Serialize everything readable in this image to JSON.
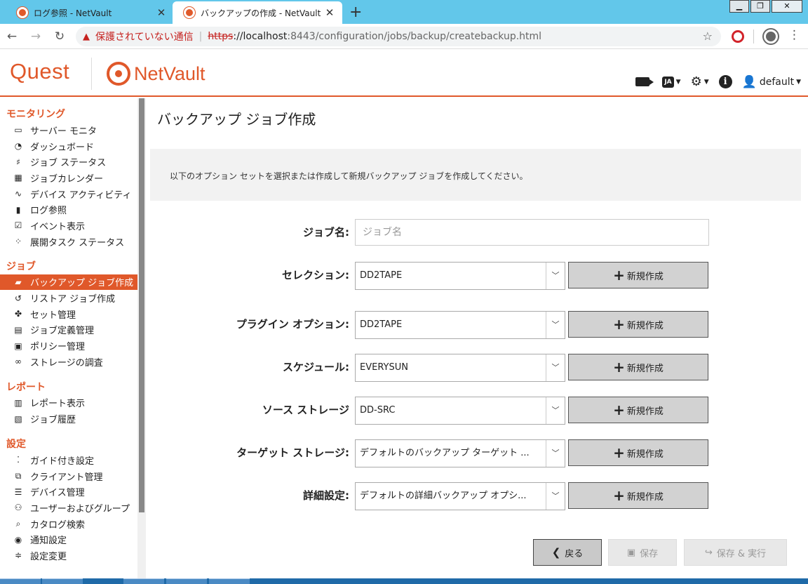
{
  "browser": {
    "tabs": [
      {
        "title": "ログ参照 - NetVault",
        "active": false
      },
      {
        "title": "バックアップの作成 - NetVault",
        "active": true
      }
    ],
    "new_tab": "+",
    "address": {
      "security_warning": "保護されていない通信",
      "scheme": "https",
      "host": "://localhost",
      "path": ":8443/configuration/jobs/backup/createbackup.html"
    }
  },
  "header": {
    "brand": "Quest",
    "product": "NetVault",
    "language": "JA",
    "user": "default"
  },
  "sidebar": {
    "groups": [
      {
        "title": "モニタリング",
        "items": [
          {
            "label": "サーバー モニタ",
            "icon": "monitor-icon"
          },
          {
            "label": "ダッシュボード",
            "icon": "gauge-icon"
          },
          {
            "label": "ジョブ ステータス",
            "icon": "job-status-icon"
          },
          {
            "label": "ジョブカレンダー",
            "icon": "calendar-icon"
          },
          {
            "label": "デバイス アクティビティ",
            "icon": "activity-icon"
          },
          {
            "label": "ログ参照",
            "icon": "log-icon"
          },
          {
            "label": "イベント表示",
            "icon": "event-icon"
          },
          {
            "label": "展開タスク ステータス",
            "icon": "spinner-icon"
          }
        ]
      },
      {
        "title": "ジョブ",
        "items": [
          {
            "label": "バックアップ ジョブ作成",
            "icon": "backup-icon",
            "active": true
          },
          {
            "label": "リストア ジョブ作成",
            "icon": "restore-icon"
          },
          {
            "label": "セット管理",
            "icon": "sets-icon"
          },
          {
            "label": "ジョブ定義管理",
            "icon": "job-definition-icon"
          },
          {
            "label": "ポリシー管理",
            "icon": "policy-icon"
          },
          {
            "label": "ストレージの調査",
            "icon": "binoculars-icon"
          }
        ]
      },
      {
        "title": "レポート",
        "items": [
          {
            "label": "レポート表示",
            "icon": "report-icon"
          },
          {
            "label": "ジョブ履歴",
            "icon": "history-icon"
          }
        ]
      },
      {
        "title": "設定",
        "items": [
          {
            "label": "ガイド付き設定",
            "icon": "footprints-icon"
          },
          {
            "label": "クライアント管理",
            "icon": "client-icon"
          },
          {
            "label": "デバイス管理",
            "icon": "device-icon"
          },
          {
            "label": "ユーザーおよびグループ",
            "icon": "users-icon"
          },
          {
            "label": "カタログ検索",
            "icon": "catalog-search-icon"
          },
          {
            "label": "通知設定",
            "icon": "notification-icon"
          },
          {
            "label": "設定変更",
            "icon": "sliders-icon"
          }
        ]
      }
    ]
  },
  "main": {
    "title": "バックアップ ジョブ作成",
    "info": "以下のオプション セットを選択または作成して新規バックアップ ジョブを作成してください。",
    "job_name": {
      "label": "ジョブ名:",
      "value": "",
      "placeholder": "ジョブ名"
    },
    "fields": [
      {
        "label": "セレクション:",
        "value": "DD2TAPE"
      },
      {
        "label": "プラグイン オプション:",
        "value": "DD2TAPE"
      },
      {
        "label": "スケジュール:",
        "value": "EVERYSUN"
      },
      {
        "label": "ソース ストレージ",
        "value": "DD-SRC"
      },
      {
        "label": "ターゲット ストレージ:",
        "value": "デフォルトのバックアップ ターゲット ..."
      },
      {
        "label": "詳細設定:",
        "value": "デフォルトの詳細バックアップ オプシ..."
      }
    ],
    "new_button_label": "新規作成",
    "buttons": {
      "back": "戻る",
      "save": "保存",
      "save_run": "保存 & 実行"
    }
  },
  "colors": {
    "accent": "#e0582a",
    "tabstrip": "#62c7ea"
  }
}
